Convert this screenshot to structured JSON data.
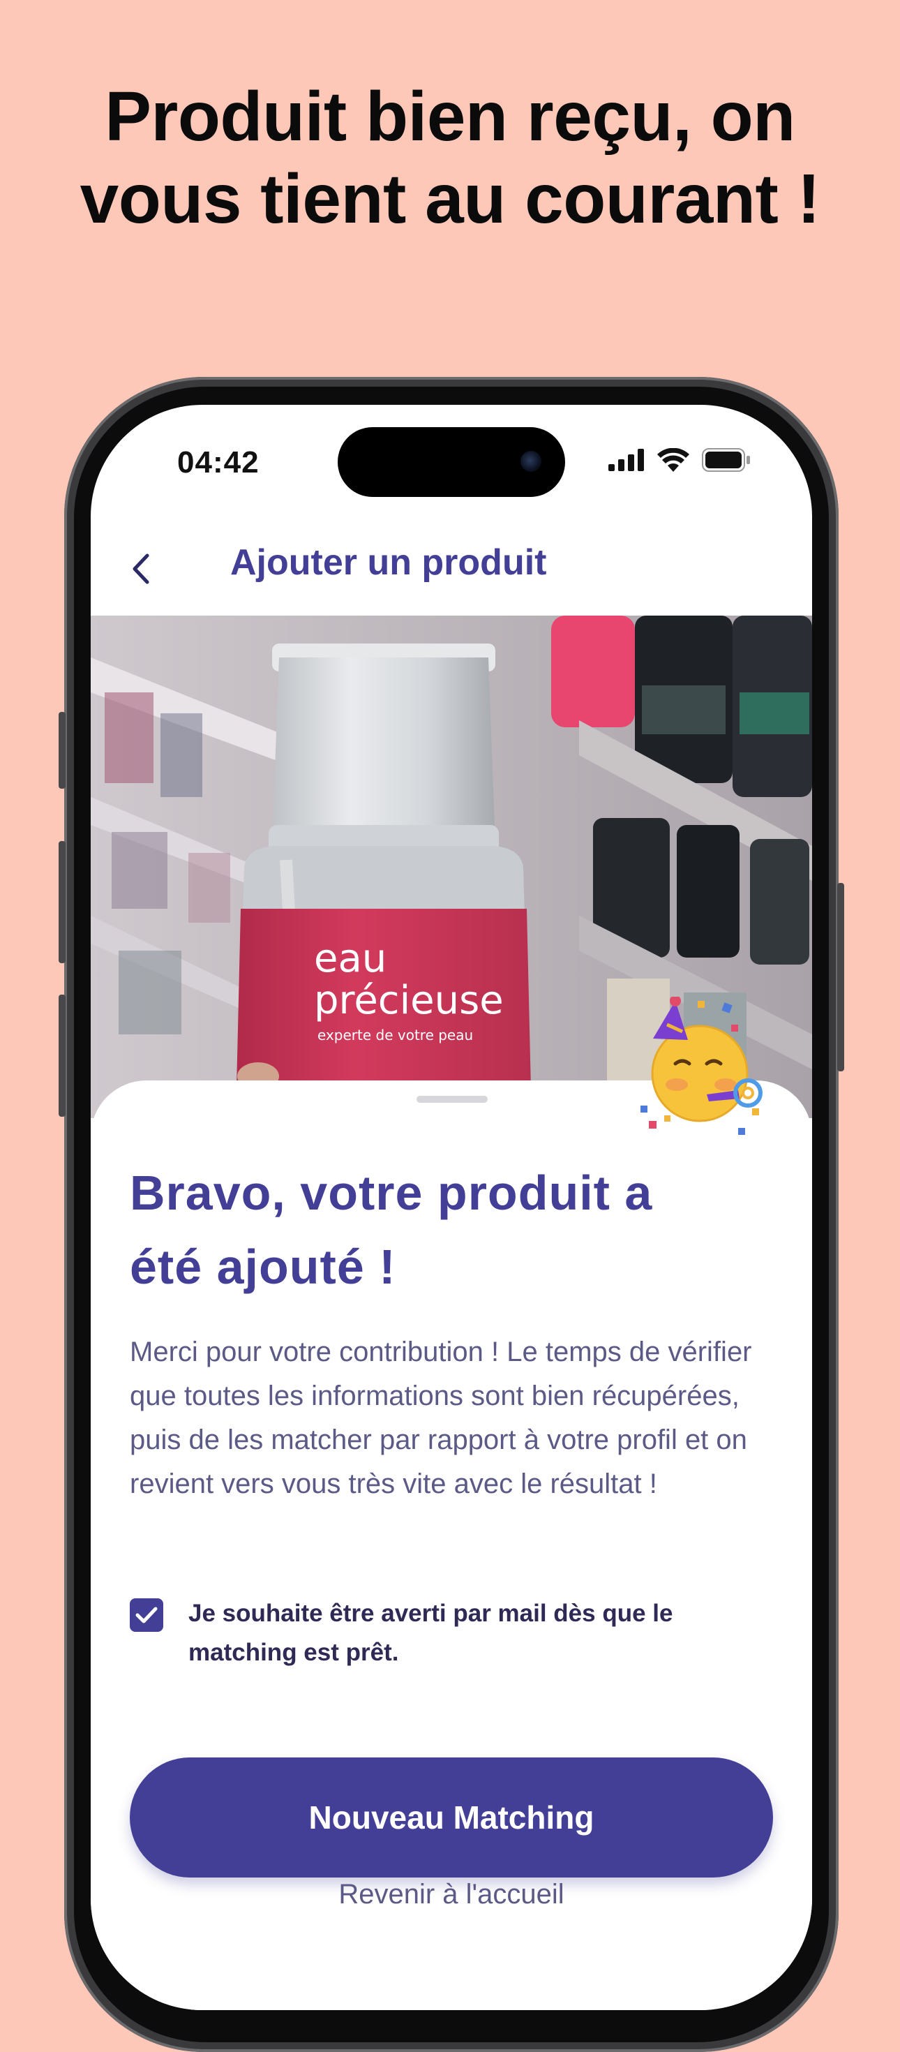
{
  "headline": {
    "line1": "Produit bien reçu, on",
    "line2": "vous tient au courant !"
  },
  "status_bar": {
    "time": "04:42",
    "icons": [
      "signal-icon",
      "wifi-icon",
      "battery-icon"
    ]
  },
  "nav": {
    "back_icon": "chevron-left-icon",
    "title": "Ajouter un produit"
  },
  "product_photo": {
    "brand_line1": "eau",
    "brand_line2": "précieuse",
    "tagline": "experte de votre peau"
  },
  "sheet": {
    "emoji": "party-face-emoji",
    "title_line1": "Bravo, votre produit a",
    "title_line2": "été ajouté !",
    "body": "Merci pour votre contribution ! Le temps de vérifier que toutes les informations sont bien récupérées, puis de les matcher par rapport à votre profil et on revient vers vous très vite avec le résultat !",
    "checkbox_checked": true,
    "checkbox_label": "Je souhaite être averti par mail dès que le matching est prêt.",
    "primary_button": "Nouveau Matching",
    "secondary_link": "Revenir à l'accueil"
  },
  "colors": {
    "background": "#FDC8B8",
    "brand_purple": "#433E96",
    "body_text": "#5B5A86",
    "product_red": "#D23A5C"
  }
}
